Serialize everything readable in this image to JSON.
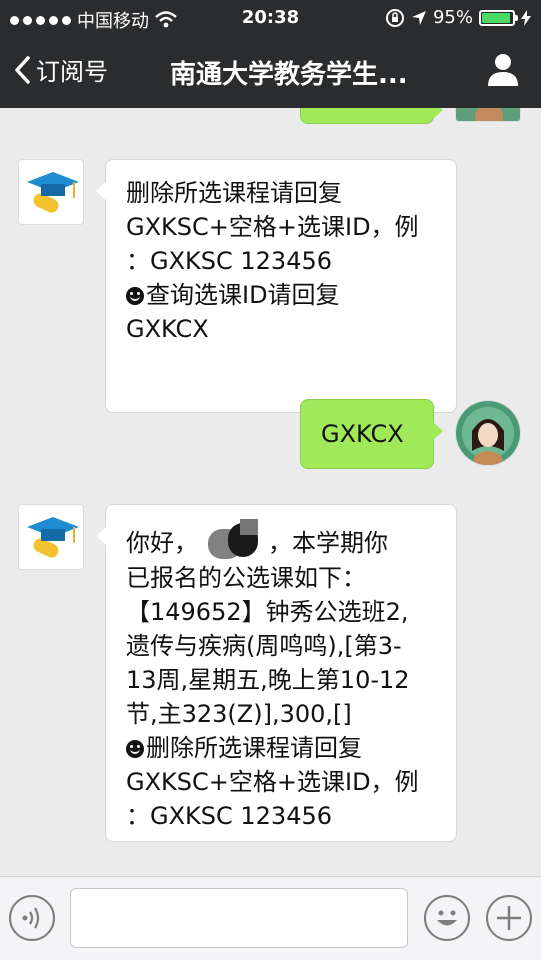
{
  "status_bar": {
    "carrier": "中国移动",
    "time": "20:38",
    "battery": "95%"
  },
  "nav": {
    "back_label": "订阅号",
    "title": "南通大学教务学生..."
  },
  "messages": {
    "bot_msg_1": {
      "line1": "删除所选课程请回复",
      "line2": "GXKSC+空格+选课ID，例",
      "line3": "：GXKSC 123456",
      "line4": "查询选课ID请回复",
      "line5": "GXKCX"
    },
    "user_msg_1": {
      "text": "GXKCX"
    },
    "bot_msg_2": {
      "greeting": "你好，",
      "greeting_end": "，本学期你",
      "line2": "已报名的公选课如下：",
      "line3": "【149652】钟秀公选班2,",
      "line4": "遗传与疾病(周鸣鸣),[第3-",
      "line5": "13周,星期五,晚上第10-12",
      "line6": "节,主323(Z)],300,[]",
      "line7": "删除所选课程请回复",
      "line8": "GXKSC+空格+选课ID，例",
      "line9": "：GXKSC 123456"
    }
  },
  "input": {
    "placeholder": ""
  },
  "colors": {
    "header_bg": "#2b2c2e",
    "chat_bg": "#ebebeb",
    "outgoing_bubble": "#a0e959",
    "incoming_bubble": "#ffffff",
    "battery_fill": "#4cd964"
  },
  "icons": {
    "signal": "signal-dots-icon",
    "wifi": "wifi-icon",
    "lock": "rotation-lock-icon",
    "location": "location-arrow-icon",
    "battery": "battery-icon",
    "charging": "charging-bolt-icon",
    "back": "chevron-left-icon",
    "profile": "person-icon",
    "voice": "voice-icon",
    "emoji": "emoji-icon",
    "plus": "plus-icon",
    "bot_avatar": "graduation-cap-icon"
  }
}
